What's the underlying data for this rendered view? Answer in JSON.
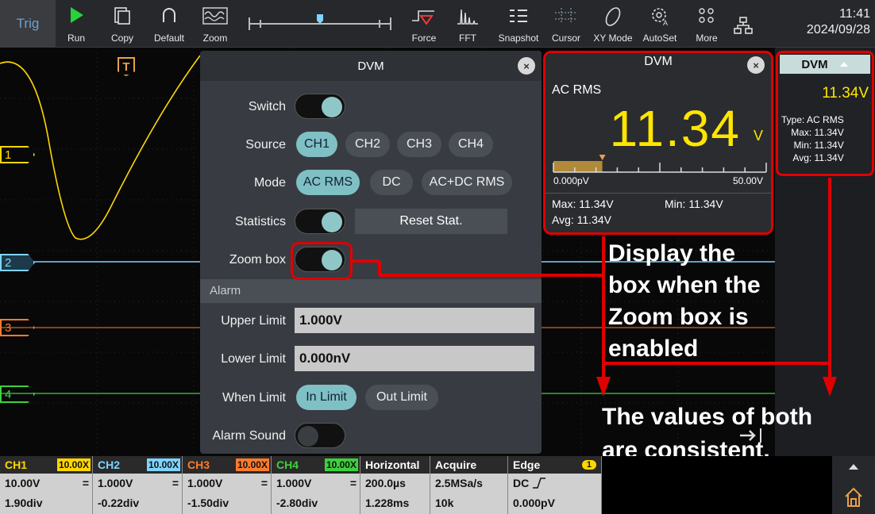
{
  "toolbar": {
    "trig": "Trig",
    "buttons": [
      "Run",
      "Copy",
      "Default",
      "Zoom",
      "Force",
      "FFT",
      "Snapshot",
      "Cursor",
      "XY Mode",
      "AutoSet",
      "More"
    ],
    "time": "11:41",
    "date": "2024/09/28"
  },
  "channels": {
    "c1": "1",
    "c2": "2",
    "c3": "3",
    "c4": "4",
    "trigger": "T"
  },
  "dvm_main": {
    "title": "DVM",
    "close": "×",
    "switch_label": "Switch",
    "source_label": "Source",
    "sources": [
      "CH1",
      "CH2",
      "CH3",
      "CH4"
    ],
    "mode_label": "Mode",
    "modes": [
      "AC RMS",
      "DC",
      "AC+DC RMS"
    ],
    "statistics_label": "Statistics",
    "reset_stat": "Reset Stat.",
    "zoom_label": "Zoom box",
    "alarm_header": "Alarm",
    "upper_label": "Upper Limit",
    "upper_value": "1.000V",
    "lower_label": "Lower Limit",
    "lower_value": "0.000nV",
    "when_label": "When Limit",
    "when_options": [
      "In Limit",
      "Out Limit"
    ],
    "sound_label": "Alarm Sound",
    "switch_on": true,
    "statistics_on": true,
    "zoom_on": true,
    "sound_on": false
  },
  "dvm_zoom": {
    "title": "DVM",
    "close": "×",
    "mode": "AC RMS",
    "value": "11.34",
    "unit": "V",
    "scale_min": "0.000pV",
    "scale_max": "50.00V",
    "bar_fraction": 0.23,
    "max": "Max: 11.34V",
    "min": "Min: 11.34V",
    "avg": "Avg: 11.34V"
  },
  "dvm_side": {
    "title": "DVM",
    "value": "11.34V",
    "type": "Type: AC RMS",
    "max": "Max: 11.34V",
    "min": "Min: 11.34V",
    "avg": "Avg: 11.34V"
  },
  "bottom": {
    "ch1": {
      "name": "CH1",
      "probe": "10.00X",
      "volt": "10.00V",
      "pos": "1.90div"
    },
    "ch2": {
      "name": "CH2",
      "probe": "10.00X",
      "volt": "1.000V",
      "pos": "-0.22div"
    },
    "ch3": {
      "name": "CH3",
      "probe": "10.00X",
      "volt": "1.000V",
      "pos": "-1.50div"
    },
    "ch4": {
      "name": "CH4",
      "probe": "10.00X",
      "volt": "1.000V",
      "pos": "-2.80div"
    },
    "horizontal": {
      "name": "Horizontal",
      "v1": "200.0µs",
      "v2": "1.228ms"
    },
    "acquire": {
      "name": "Acquire",
      "v1": "2.5MSa/s",
      "v2": "10k"
    },
    "edge": {
      "name": "Edge",
      "badge": "1",
      "v1": "DC",
      "v2": "0.000pV"
    },
    "coupling": "="
  },
  "annotations": {
    "a1": [
      "Display the",
      "box when the",
      "Zoom box is",
      "enabled"
    ],
    "a2": [
      "The values of both",
      "are consistent."
    ]
  },
  "colors": {
    "ch1": "#ffd700",
    "ch2": "#7fd4ff",
    "ch3": "#ff7b2e",
    "ch4": "#3dd23d",
    "accent": "#7fc0c4",
    "alert": "#e00000"
  }
}
